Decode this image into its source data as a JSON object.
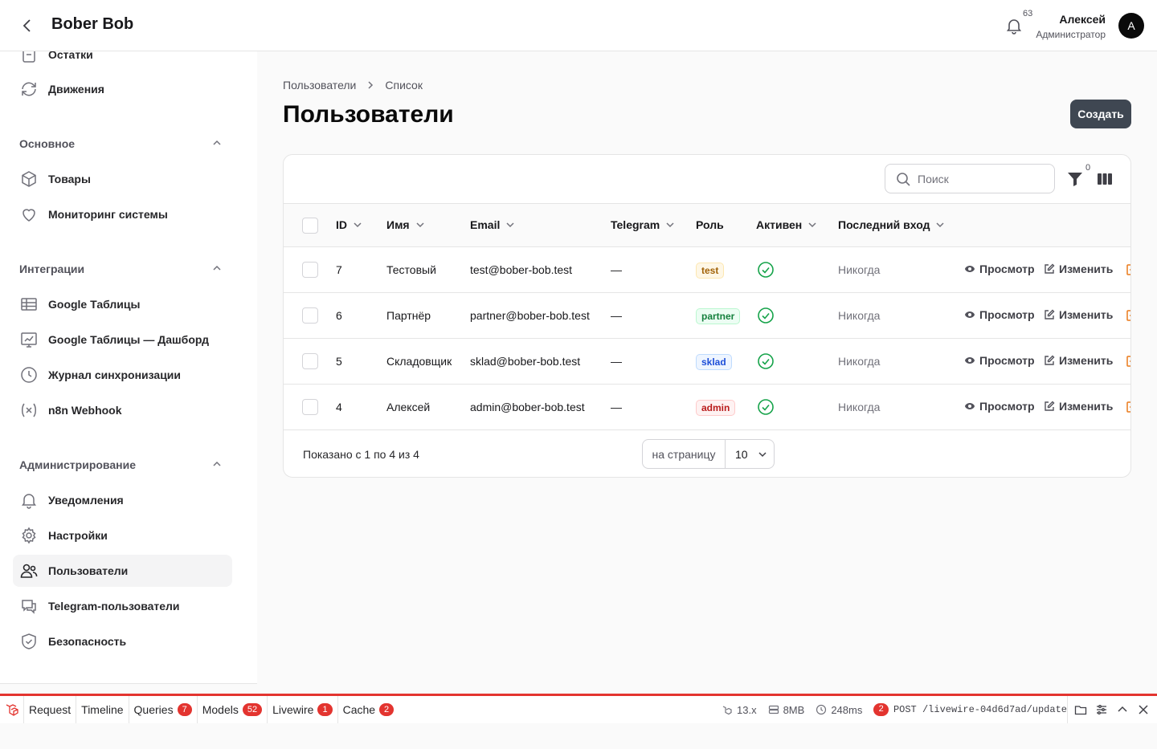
{
  "header": {
    "brand": "Bober Bob",
    "notifications_count": "63",
    "user_name": "Алексей",
    "user_role": "Администратор",
    "avatar_letter": "A"
  },
  "sidebar": {
    "top_items": [
      {
        "label": "Остатки",
        "icon": "clipboard-icon"
      },
      {
        "label": "Движения",
        "icon": "refresh-icon"
      }
    ],
    "groups": [
      {
        "label": "Основное",
        "items": [
          {
            "label": "Товары",
            "icon": "cube-icon"
          },
          {
            "label": "Мониторинг системы",
            "icon": "heart-icon"
          }
        ]
      },
      {
        "label": "Интеграции",
        "items": [
          {
            "label": "Google Таблицы",
            "icon": "table-icon"
          },
          {
            "label": "Google Таблицы — Дашборд",
            "icon": "chart-icon"
          },
          {
            "label": "Журнал синхронизации",
            "icon": "clock-icon"
          },
          {
            "label": "n8n Webhook",
            "icon": "variable-icon"
          }
        ]
      },
      {
        "label": "Администрирование",
        "items": [
          {
            "label": "Уведомления",
            "icon": "bell-icon"
          },
          {
            "label": "Настройки",
            "icon": "gear-icon"
          },
          {
            "label": "Пользователи",
            "icon": "users-icon",
            "active": true
          },
          {
            "label": "Telegram-пользователи",
            "icon": "chat-icon"
          },
          {
            "label": "Безопасность",
            "icon": "shield-icon"
          }
        ]
      }
    ]
  },
  "breadcrumb": [
    "Пользователи",
    "Список"
  ],
  "page_title": "Пользователи",
  "create_label": "Создать",
  "table": {
    "search_placeholder": "Поиск",
    "filter_count": "0",
    "columns": [
      "ID",
      "Имя",
      "Email",
      "Telegram",
      "Роль",
      "Активен",
      "Последний вход"
    ],
    "rows": [
      {
        "id": "7",
        "name": "Тестовый",
        "email": "test@bober-bob.test",
        "telegram": "—",
        "role": "test",
        "active": true,
        "last_login": "Никогда"
      },
      {
        "id": "6",
        "name": "Партнёр",
        "email": "partner@bober-bob.test",
        "telegram": "—",
        "role": "partner",
        "active": true,
        "last_login": "Никогда"
      },
      {
        "id": "5",
        "name": "Складовщик",
        "email": "sklad@bober-bob.test",
        "telegram": "—",
        "role": "sklad",
        "active": true,
        "last_login": "Никогда"
      },
      {
        "id": "4",
        "name": "Алексей",
        "email": "admin@bober-bob.test",
        "telegram": "—",
        "role": "admin",
        "active": true,
        "last_login": "Никогда"
      }
    ],
    "view_label": "Просмотр",
    "edit_label": "Изменить",
    "summary": "Показано с 1 по 4 из 4",
    "per_page_label": "на страницу",
    "per_page_value": "10"
  },
  "debugbar": {
    "tabs": [
      {
        "label": "Request"
      },
      {
        "label": "Timeline"
      },
      {
        "label": "Queries",
        "badge": "7"
      },
      {
        "label": "Models",
        "badge": "52"
      },
      {
        "label": "Livewire",
        "badge": "1"
      },
      {
        "label": "Cache",
        "badge": "2"
      }
    ],
    "version": "13.x",
    "memory": "8MB",
    "duration": "248ms",
    "requests_count": "2",
    "request": "POST /livewire-04d6d7ad/update"
  },
  "colors": {
    "accent_button": "#3f4752",
    "debug_red": "#e3342f",
    "success": "#16a34a"
  }
}
